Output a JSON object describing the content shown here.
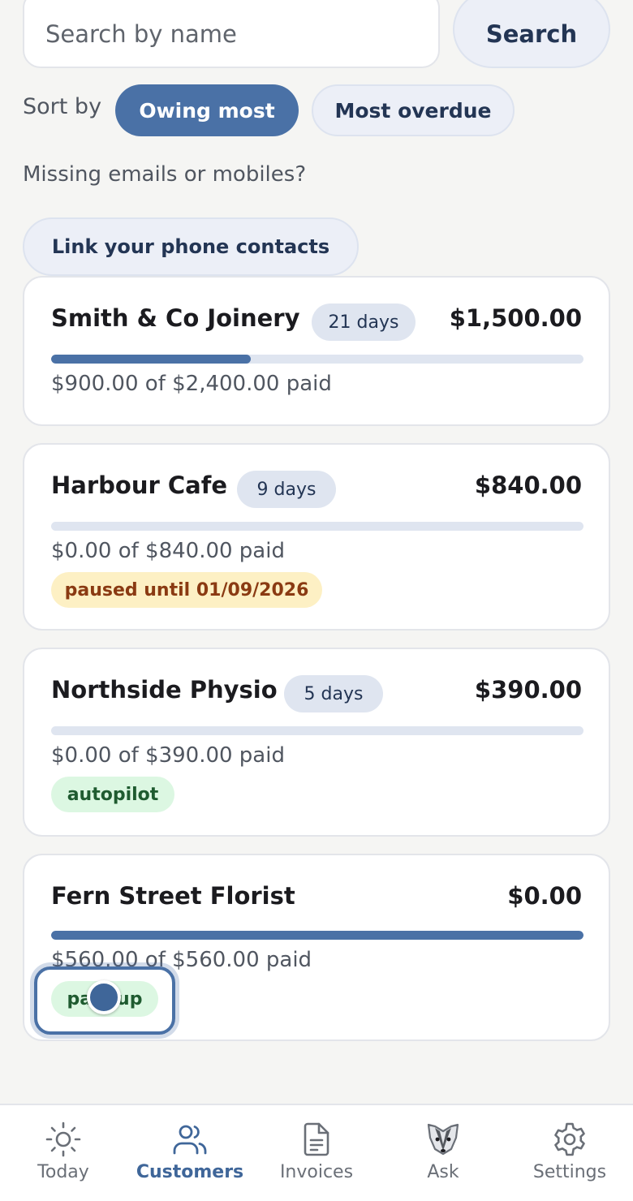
{
  "search": {
    "placeholder": "Search by name",
    "button_label": "Search"
  },
  "sort": {
    "label": "Sort by",
    "options": [
      {
        "label": "Owing most",
        "selected": true
      },
      {
        "label": "Most overdue",
        "selected": false
      }
    ]
  },
  "contacts_prompt": {
    "text": "Missing emails or mobiles?",
    "button_label": "Link your phone contacts"
  },
  "customers": [
    {
      "name": "Smith & Co Joinery",
      "days": "21 days",
      "amount": "$1,500.00",
      "paid_text": "$900.00 of $2,400.00 paid",
      "paid_fraction": 0.375,
      "tag": ""
    },
    {
      "name": "Harbour Cafe",
      "days": "9 days",
      "amount": "$840.00",
      "paid_text": "$0.00 of $840.00 paid",
      "paid_fraction": 0,
      "tag": "paused until 01/09/2026"
    },
    {
      "name": "Northside Physio",
      "days": "5 days",
      "amount": "$390.00",
      "paid_text": "$0.00 of $390.00 paid",
      "paid_fraction": 0,
      "tag": "autopilot"
    },
    {
      "name": "Fern Street Florist",
      "days": "",
      "amount": "$0.00",
      "paid_text": "$560.00 of $560.00 paid",
      "paid_fraction": 1,
      "tag": "paid up"
    }
  ],
  "nav": {
    "items": [
      {
        "label": "Today",
        "icon": "sun-icon",
        "active": false
      },
      {
        "label": "Customers",
        "icon": "users-icon",
        "active": true
      },
      {
        "label": "Invoices",
        "icon": "document-icon",
        "active": false
      },
      {
        "label": "Ask",
        "icon": "badger-icon",
        "active": false
      },
      {
        "label": "Settings",
        "icon": "gear-icon",
        "active": false
      }
    ]
  },
  "colors": {
    "accent": "#4a71a6",
    "page_background": "#f5f5f3",
    "paused_background": "#fdf0c4",
    "paused_text": "#8a3a12",
    "green_background": "#dcf7e2",
    "green_text": "#1f5b30"
  }
}
